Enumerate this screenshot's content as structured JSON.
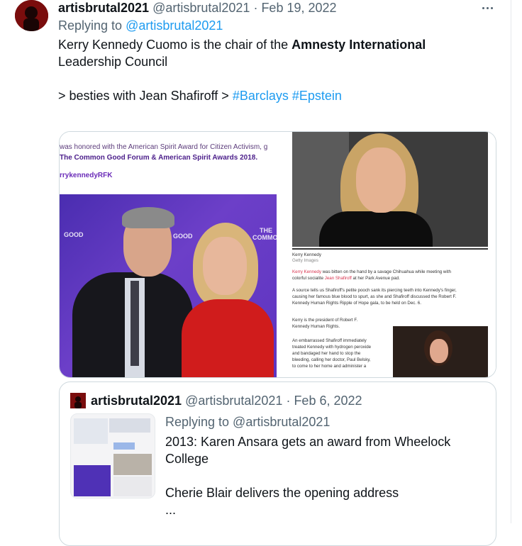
{
  "tweet": {
    "author_name": "artisbrutal2021",
    "author_handle": "@artisbrutal2021",
    "separator": "·",
    "date": "Feb 19, 2022",
    "replying_prefix": "Replying to",
    "replying_to": "@artisbrutal2021",
    "line1_prefix": "Kerry Kennedy Cuomo is the chair of the ",
    "line1_bold": "Amnesty International",
    "line2": "Leadership Council",
    "line3_prefix": "> besties with Jean Shafiroff > ",
    "hashtag1": "#Barclays",
    "hashtag2": "#Epstein"
  },
  "media": {
    "left_caption1": "was honored with the American Spirit Award for Citizen Activism, g",
    "left_caption2": "The Common Good Forum & American Spirit Awards 2018.",
    "left_caption3": "rrykennedyRFK",
    "backdrop1": "GOOD",
    "backdrop2": "GOOD",
    "backdrop3": "THE",
    "backdrop4": "COMMO",
    "right_photo_caption": "Kerry Kennedy",
    "right_photo_credit": "Getty Images",
    "article_p1_a": "Kerry Kennedy",
    "article_p1_b": " was bitten on the hand by a savage Chihuahua while meeting with",
    "article_p1_c": "colorful socialite ",
    "article_p1_d": "Jean Shafiroff",
    "article_p1_e": " at her Park Avenue pad.",
    "article_p2_l1": "A source tells us Shafiroff's petite pooch sank its piercing teeth into Kennedy's finger,",
    "article_p2_l2": "causing her famous blue blood to spurt, as she and Shafiroff discussed the Robert F.",
    "article_p2_l3": "Kennedy Human Rights Ripple of Hope gala, to be held on Dec. 6.",
    "article_p3_l1": "Kerry is the president of Robert F.",
    "article_p3_l2": "Kennedy Human Rights.",
    "article_p4_l1": "An embarrassed Shafiroff immediately",
    "article_p4_l2": "treated Kennedy with hydrogen peroxide",
    "article_p4_l3": "and bandaged her hand to stop the",
    "article_p4_l4": "bleeding, calling her doctor, Paul Belsky,",
    "article_p4_l5": "to come to her home and administer a"
  },
  "quote": {
    "author_name": "artisbrutal2021",
    "author_handle": "@artisbrutal2021",
    "separator": "·",
    "date": "Feb 6, 2022",
    "replying_line": "Replying to @artisbrutal2021",
    "line1": "2013: Karen Ansara gets an award from Wheelock",
    "line2": "College",
    "line3": "Cherie Blair delivers the opening address",
    "line4": "..."
  }
}
